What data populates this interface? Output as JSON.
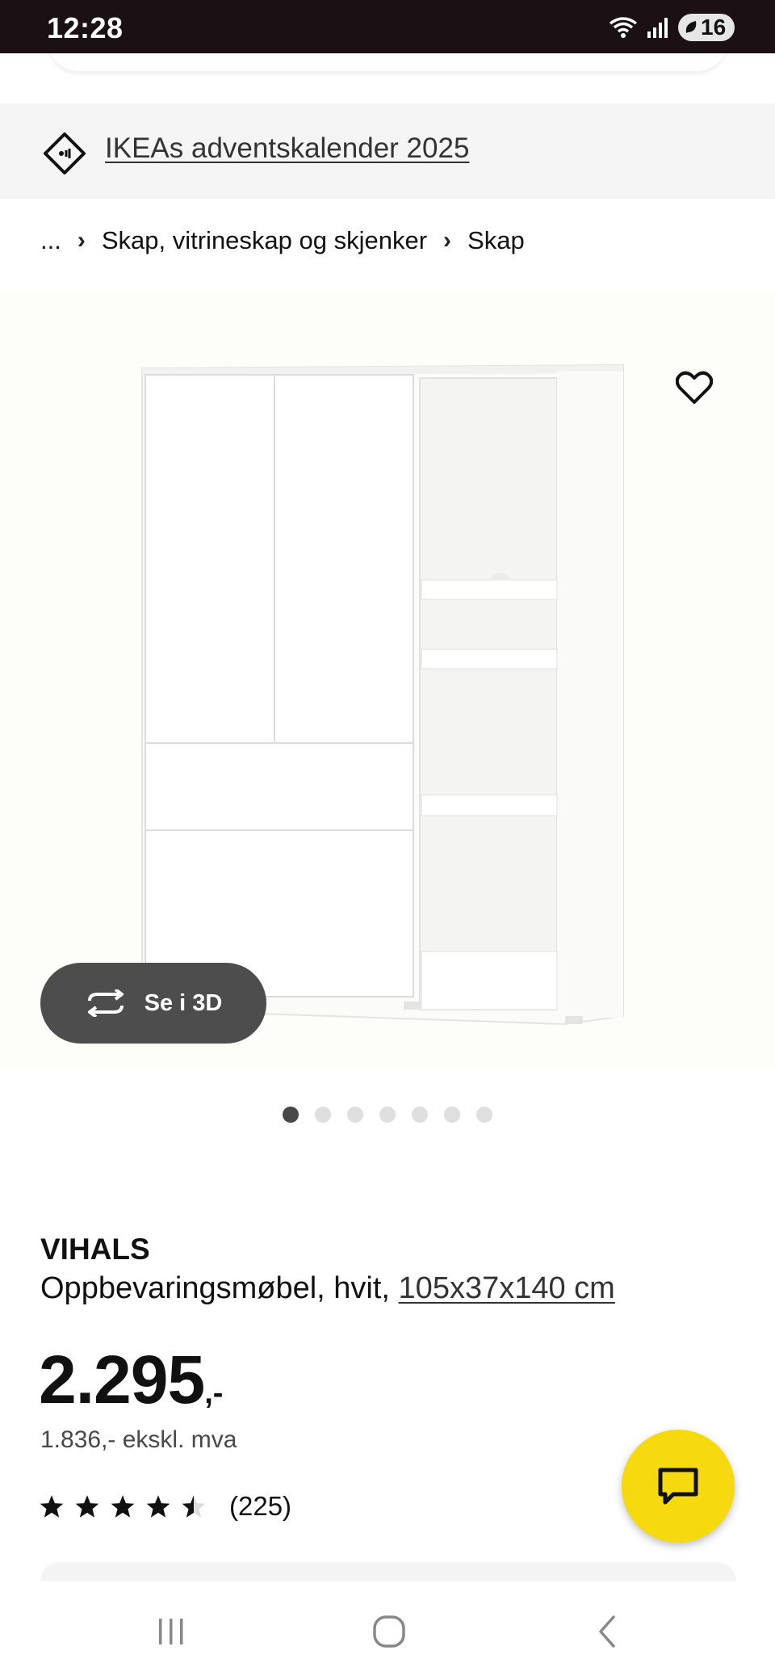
{
  "status_bar": {
    "time": "12:28",
    "battery": "16"
  },
  "promo": {
    "link_text": "IKEAs adventskalender 2025",
    "icon": "price-tag-icon"
  },
  "breadcrumb": {
    "ellipsis": "...",
    "items": [
      "Skap, vitrineskap og skjenker",
      "Skap"
    ]
  },
  "gallery": {
    "view_3d_label": "Se i 3D",
    "total_images": 7,
    "active_index": 0
  },
  "product": {
    "name": "VIHALS",
    "description": "Oppbevaringsmøbel, hvit,",
    "dimensions": "105x37x140 cm",
    "price": "2.295",
    "price_suffix": ",-",
    "price_ex_vat": "1.836,- ekskl. mva",
    "rating": 4.5,
    "review_count": "(225)"
  },
  "colors": {
    "accent_yellow": "#f6d90f",
    "status_bar": "#1b1114",
    "button_dark": "#4d4d4d"
  }
}
